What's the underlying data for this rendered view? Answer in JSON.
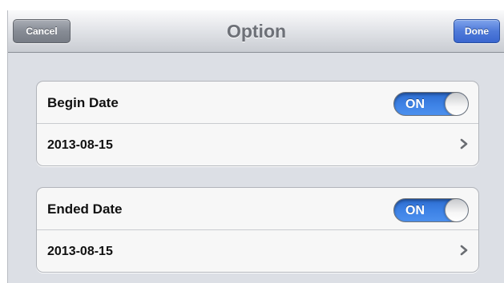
{
  "navbar": {
    "title": "Option",
    "cancel_label": "Cancel",
    "done_label": "Done"
  },
  "groups": [
    {
      "label": "Begin Date",
      "toggle": {
        "state": "ON",
        "on": true
      },
      "value": "2013-08-15",
      "chevron_icon": "chevron-right-icon"
    },
    {
      "label": "Ended Date",
      "toggle": {
        "state": "ON",
        "on": true
      },
      "value": "2013-08-15",
      "chevron_icon": "chevron-right-icon"
    }
  ],
  "colors": {
    "toggle_on": "#3e83e6",
    "done_button": "#4f7ad9",
    "cancel_button": "#878c95",
    "background": "#dcdfe5"
  }
}
